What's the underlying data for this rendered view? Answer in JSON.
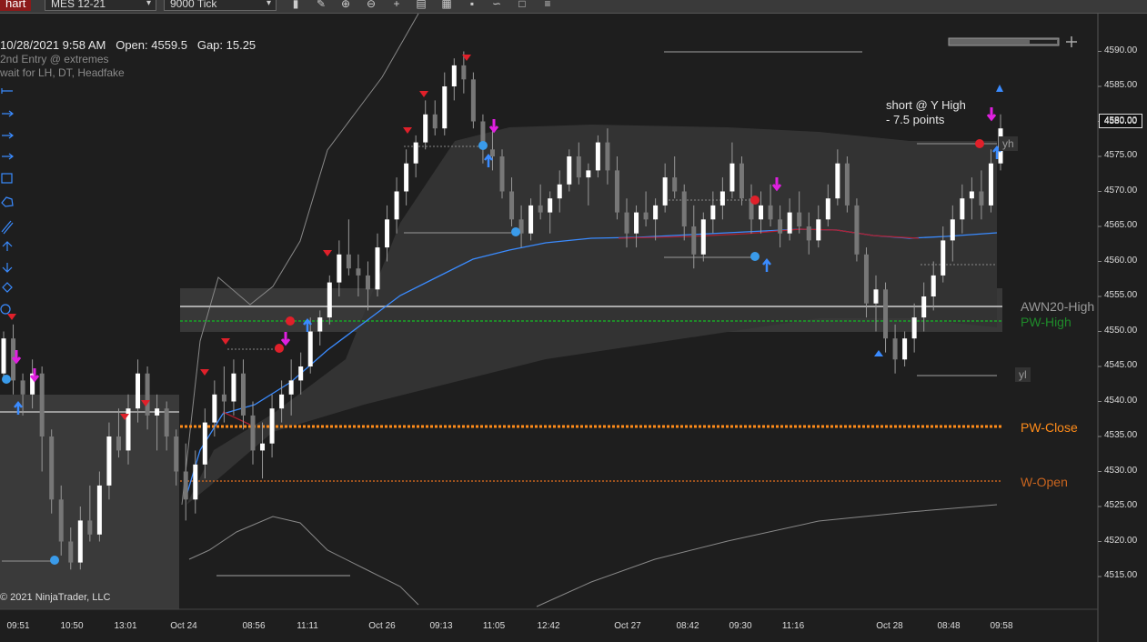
{
  "toolbar": {
    "tab_label": "hart",
    "instrument": "MES 12-21",
    "interval": "9000 Tick",
    "icons": [
      "bar-style-icon",
      "pencil-icon",
      "zoom-in-icon",
      "zoom-out-icon",
      "crosshair-icon",
      "properties-icon",
      "strategies-icon",
      "indicators-icon",
      "trend-icon",
      "snapshot-icon",
      "menu-icon"
    ]
  },
  "info": {
    "line1": "10/28/2021 9:58 AM   Open: 4559.5   Gap: 15.25",
    "line2": "2nd Entry @ extremes",
    "line3": "wait for LH, DT, Headfake"
  },
  "annotation": {
    "line1": "short @ Y High",
    "line2": "- 7.5 points"
  },
  "levels": {
    "awn20_high": "AWN20-High",
    "pw_high": "PW-High",
    "pw_close": "PW-Close",
    "w_open": "W-Open",
    "yl": "yl",
    "yh": "yh"
  },
  "price_flag": "4580.00",
  "copyright": "© 2021 NinjaTrader, LLC",
  "colors": {
    "up": "#ffffff",
    "down": "#777777",
    "ema": "#3a8bff",
    "pw_close": "#ff8c1a",
    "w_open": "#c8641e",
    "pw_high": "#1f8a2a",
    "signal_red": "#e0202a",
    "signal_blue": "#3a9bea",
    "arrow_magenta": "#e020e0"
  },
  "chart_data": {
    "type": "candlestick",
    "instrument": "MES 12-21",
    "interval": "9000 Tick",
    "y_ticks": [
      4590,
      4585,
      4580,
      4575,
      4570,
      4565,
      4560,
      4555,
      4550,
      4545,
      4540,
      4535,
      4530,
      4525,
      4520,
      4515
    ],
    "ylim": [
      4510.5,
      4593.5
    ],
    "x_labels": [
      "09:51",
      "10:50",
      "13:01",
      "Oct 24",
      "08:56",
      "11:11",
      "Oct 26",
      "09:13",
      "11:05",
      "12:42",
      "Oct 27",
      "08:42",
      "09:30",
      "11:16",
      "Oct 28",
      "08:48",
      "09:58"
    ],
    "last_price": 4580.0,
    "horizontal_levels": [
      {
        "name": "AWN20-High",
        "value": 4553.8
      },
      {
        "name": "PW-High",
        "value": 4552.0
      },
      {
        "name": "PW-Close",
        "value": 4536.6
      },
      {
        "name": "W-Open",
        "value": 4528.8
      }
    ],
    "candles": [
      [
        4544,
        4550,
        4543,
        4549
      ],
      [
        4549,
        4551,
        4541,
        4543
      ],
      [
        4543,
        4544,
        4538,
        4541
      ],
      [
        4541,
        4546,
        4539,
        4544
      ],
      [
        4544,
        4545,
        4530,
        4535
      ],
      [
        4535,
        4536,
        4524,
        4526
      ],
      [
        4526,
        4528,
        4518,
        4520
      ],
      [
        4520,
        4522,
        4516,
        4517
      ],
      [
        4517,
        4525,
        4516,
        4523
      ],
      [
        4523,
        4528,
        4520,
        4521
      ],
      [
        4521,
        4530,
        4520,
        4528
      ],
      [
        4528,
        4537,
        4526,
        4535
      ],
      [
        4535,
        4539,
        4532,
        4533
      ],
      [
        4533,
        4541,
        4531,
        4539
      ],
      [
        4539,
        4546,
        4537,
        4544
      ],
      [
        4544,
        4545,
        4536,
        4538
      ],
      [
        4538,
        4541,
        4533,
        4539
      ],
      [
        4539,
        4540,
        4533,
        4535
      ],
      [
        4535,
        4536,
        4528,
        4530
      ],
      [
        4530,
        4534,
        4523,
        4526
      ],
      [
        4526,
        4533,
        4524,
        4531
      ],
      [
        4531,
        4539,
        4529,
        4537
      ],
      [
        4537,
        4543,
        4535,
        4541
      ],
      [
        4541,
        4545,
        4537,
        4540
      ],
      [
        4540,
        4546,
        4538,
        4544
      ],
      [
        4544,
        4546,
        4536,
        4538
      ],
      [
        4538,
        4540,
        4531,
        4533
      ],
      [
        4533,
        4537,
        4529,
        4534
      ],
      [
        4534,
        4541,
        4532,
        4539
      ],
      [
        4539,
        4543,
        4537,
        4541
      ],
      [
        4541,
        4546,
        4538,
        4543
      ],
      [
        4543,
        4547,
        4541,
        4545
      ],
      [
        4545,
        4552,
        4544,
        4550
      ],
      [
        4550,
        4553,
        4548,
        4552
      ],
      [
        4552,
        4558,
        4551,
        4557
      ],
      [
        4557,
        4563,
        4555,
        4561
      ],
      [
        4561,
        4566,
        4558,
        4559
      ],
      [
        4559,
        4561,
        4555,
        4558
      ],
      [
        4558,
        4560,
        4553,
        4556
      ],
      [
        4556,
        4564,
        4555,
        4562
      ],
      [
        4562,
        4568,
        4560,
        4566
      ],
      [
        4566,
        4572,
        4564,
        4570
      ],
      [
        4570,
        4576,
        4568,
        4574
      ],
      [
        4574,
        4578,
        4572,
        4577
      ],
      [
        4577,
        4583,
        4576,
        4581
      ],
      [
        4581,
        4583,
        4578,
        4579
      ],
      [
        4579,
        4587,
        4578,
        4585
      ],
      [
        4585,
        4589,
        4583,
        4588
      ],
      [
        4588,
        4590,
        4584,
        4586
      ],
      [
        4586,
        4587,
        4579,
        4580
      ],
      [
        4580,
        4581,
        4574,
        4576
      ],
      [
        4576,
        4579,
        4573,
        4575
      ],
      [
        4575,
        4576,
        4569,
        4570
      ],
      [
        4570,
        4572,
        4565,
        4566
      ],
      [
        4566,
        4568,
        4562,
        4564
      ],
      [
        4564,
        4569,
        4563,
        4568
      ],
      [
        4568,
        4571,
        4566,
        4567
      ],
      [
        4567,
        4570,
        4564,
        4569
      ],
      [
        4569,
        4573,
        4567,
        4571
      ],
      [
        4571,
        4576,
        4570,
        4575
      ],
      [
        4575,
        4577,
        4571,
        4572
      ],
      [
        4572,
        4574,
        4568,
        4573
      ],
      [
        4573,
        4578,
        4572,
        4577
      ],
      [
        4577,
        4579,
        4571,
        4573
      ],
      [
        4573,
        4575,
        4566,
        4567
      ],
      [
        4567,
        4569,
        4562,
        4564
      ],
      [
        4564,
        4568,
        4562,
        4567
      ],
      [
        4567,
        4570,
        4565,
        4566
      ],
      [
        4566,
        4569,
        4563,
        4568
      ],
      [
        4568,
        4574,
        4567,
        4572
      ],
      [
        4572,
        4575,
        4569,
        4570
      ],
      [
        4570,
        4571,
        4563,
        4565
      ],
      [
        4565,
        4568,
        4559,
        4561
      ],
      [
        4561,
        4567,
        4560,
        4566
      ],
      [
        4566,
        4570,
        4564,
        4568
      ],
      [
        4568,
        4572,
        4566,
        4570
      ],
      [
        4570,
        4577,
        4569,
        4574
      ],
      [
        4574,
        4575,
        4568,
        4569
      ],
      [
        4569,
        4571,
        4564,
        4566
      ],
      [
        4566,
        4570,
        4564,
        4568
      ],
      [
        4568,
        4571,
        4565,
        4566
      ],
      [
        4566,
        4568,
        4562,
        4564
      ],
      [
        4564,
        4569,
        4563,
        4567
      ],
      [
        4567,
        4570,
        4564,
        4565
      ],
      [
        4565,
        4567,
        4561,
        4563
      ],
      [
        4563,
        4568,
        4562,
        4566
      ],
      [
        4566,
        4571,
        4565,
        4569
      ],
      [
        4569,
        4576,
        4568,
        4574
      ],
      [
        4574,
        4575,
        4567,
        4568
      ],
      [
        4568,
        4569,
        4560,
        4561
      ],
      [
        4561,
        4562,
        4552,
        4554
      ],
      [
        4554,
        4558,
        4550,
        4556
      ],
      [
        4556,
        4557,
        4547,
        4549
      ],
      [
        4549,
        4551,
        4544,
        4546
      ],
      [
        4546,
        4550,
        4545,
        4549
      ],
      [
        4549,
        4554,
        4547,
        4552
      ],
      [
        4552,
        4557,
        4550,
        4555
      ],
      [
        4555,
        4560,
        4553,
        4558
      ],
      [
        4558,
        4565,
        4557,
        4563
      ],
      [
        4563,
        4568,
        4560,
        4566
      ],
      [
        4566,
        4571,
        4564,
        4569
      ],
      [
        4569,
        4572,
        4566,
        4570
      ],
      [
        4570,
        4573,
        4566,
        4568
      ],
      [
        4568,
        4576,
        4567,
        4574
      ],
      [
        4574,
        4581,
        4573,
        4579
      ]
    ]
  }
}
